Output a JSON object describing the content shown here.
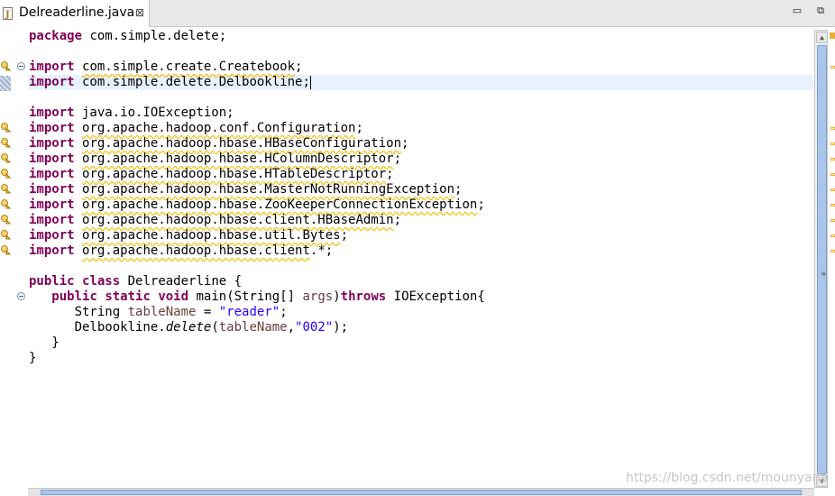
{
  "tab": {
    "title": "Delreaderline.java",
    "close": "⊠"
  },
  "window": {
    "minimize": "▭",
    "maximize": "⧉"
  },
  "editor": {
    "lines": {
      "l1": {
        "kw": "package",
        "rest": " com.simple.delete;"
      },
      "l3": {
        "kw": "import",
        "sp": " ",
        "pkg": "com.simple.create.Createbook",
        "end": ";"
      },
      "l4": {
        "kw": "import",
        "rest": " com.simple.delete.Delbookline;"
      },
      "l6": {
        "kw": "import",
        "rest": " java.io.IOException;"
      },
      "l7": {
        "kw": "import",
        "sp": " ",
        "pkg": "org.apache.hadoop.conf.Configuration",
        "end": ";"
      },
      "l8": {
        "kw": "import",
        "sp": " ",
        "pkg": "org.apache.hadoop.hbase.HBaseConfiguration",
        "end": ";"
      },
      "l9": {
        "kw": "import",
        "sp": " ",
        "pkg": "org.apache.hadoop.hbase.HColumnDescriptor",
        "end": ";"
      },
      "l10": {
        "kw": "import",
        "sp": " ",
        "pkg": "org.apache.hadoop.hbase.HTableDescriptor",
        "end": ";"
      },
      "l11": {
        "kw": "import",
        "sp": " ",
        "pkg": "org.apache.hadoop.hbase.MasterNotRunningException",
        "end": ";"
      },
      "l12": {
        "kw": "import",
        "sp": " ",
        "pkg": "org.apache.hadoop.hbase.ZooKeeperConnectionException",
        "end": ";"
      },
      "l13": {
        "kw": "import",
        "sp": " ",
        "pkg": "org.apache.hadoop.hbase.client.HBaseAdmin",
        "end": ";"
      },
      "l14": {
        "kw": "import",
        "sp": " ",
        "pkg": "org.apache.hadoop.hbase.util.Bytes",
        "end": ";"
      },
      "l15": {
        "kw": "import",
        "sp": " ",
        "pkg": "org.apache.hadoop.hbase.client",
        "end": ".*;"
      },
      "l17": {
        "kw1": "public",
        "sp1": " ",
        "kw2": "class",
        "rest": " Delreaderline {"
      },
      "l18": {
        "indent": "   ",
        "kw1": "public",
        "sp1": " ",
        "kw2": "static",
        "sp2": " ",
        "kw3": "void",
        "mid": " main(String[] ",
        "var": "args",
        "paren": ")",
        "kw4": "throws",
        "rest": " IOException{"
      },
      "l19": {
        "indent": "      ",
        "type": "String",
        "sp": " ",
        "var": "tableName",
        "eq": " = ",
        "str": "\"reader\"",
        "end": ";"
      },
      "l20": {
        "indent": "      ",
        "cls": "Delbookline.",
        "method": "delete",
        "open": "(",
        "var": "tableName",
        "comma": ",",
        "str": "\"002\"",
        "end": ");"
      },
      "l21": {
        "text": "   }"
      },
      "l22": {
        "text": "}"
      }
    }
  },
  "watermark": "https://blog.csdn.net/mounyana"
}
